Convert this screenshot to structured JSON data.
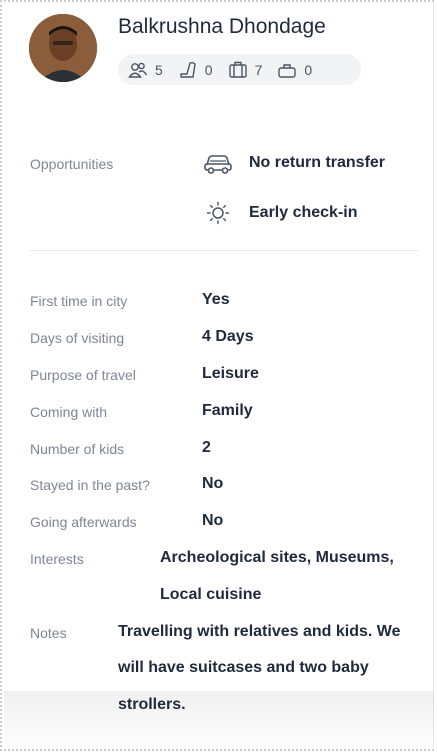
{
  "profile": {
    "name": "Balkrushna Dhondage",
    "stats": [
      {
        "icon": "people-icon",
        "value": "5"
      },
      {
        "icon": "seat-icon",
        "value": "0"
      },
      {
        "icon": "luggage-icon",
        "value": "7"
      },
      {
        "icon": "bag-icon",
        "value": "0"
      }
    ]
  },
  "opportunities": {
    "label": "Opportunities",
    "items": [
      {
        "icon": "car-icon",
        "text": "No return transfer"
      },
      {
        "icon": "sun-icon",
        "text": "Early check-in"
      }
    ]
  },
  "details": [
    {
      "label": "First time in city",
      "value": "Yes"
    },
    {
      "label": "Days of visiting",
      "value": "4 Days"
    },
    {
      "label": "Purpose of travel",
      "value": "Leisure"
    },
    {
      "label": "Coming with",
      "value": "Family"
    },
    {
      "label": "Number of kids",
      "value": "2"
    },
    {
      "label": "Stayed in the past?",
      "value": "No"
    },
    {
      "label": "Going afterwards",
      "value": "No"
    }
  ],
  "interests": {
    "label": "Interests",
    "line1": "Archeological sites, Museums,",
    "line2": "Local cuisine"
  },
  "notes": {
    "label": "Notes",
    "line1": "Travelling with relatives and kids. We",
    "line2": "will have suitcases and two baby",
    "line3": "strollers."
  }
}
